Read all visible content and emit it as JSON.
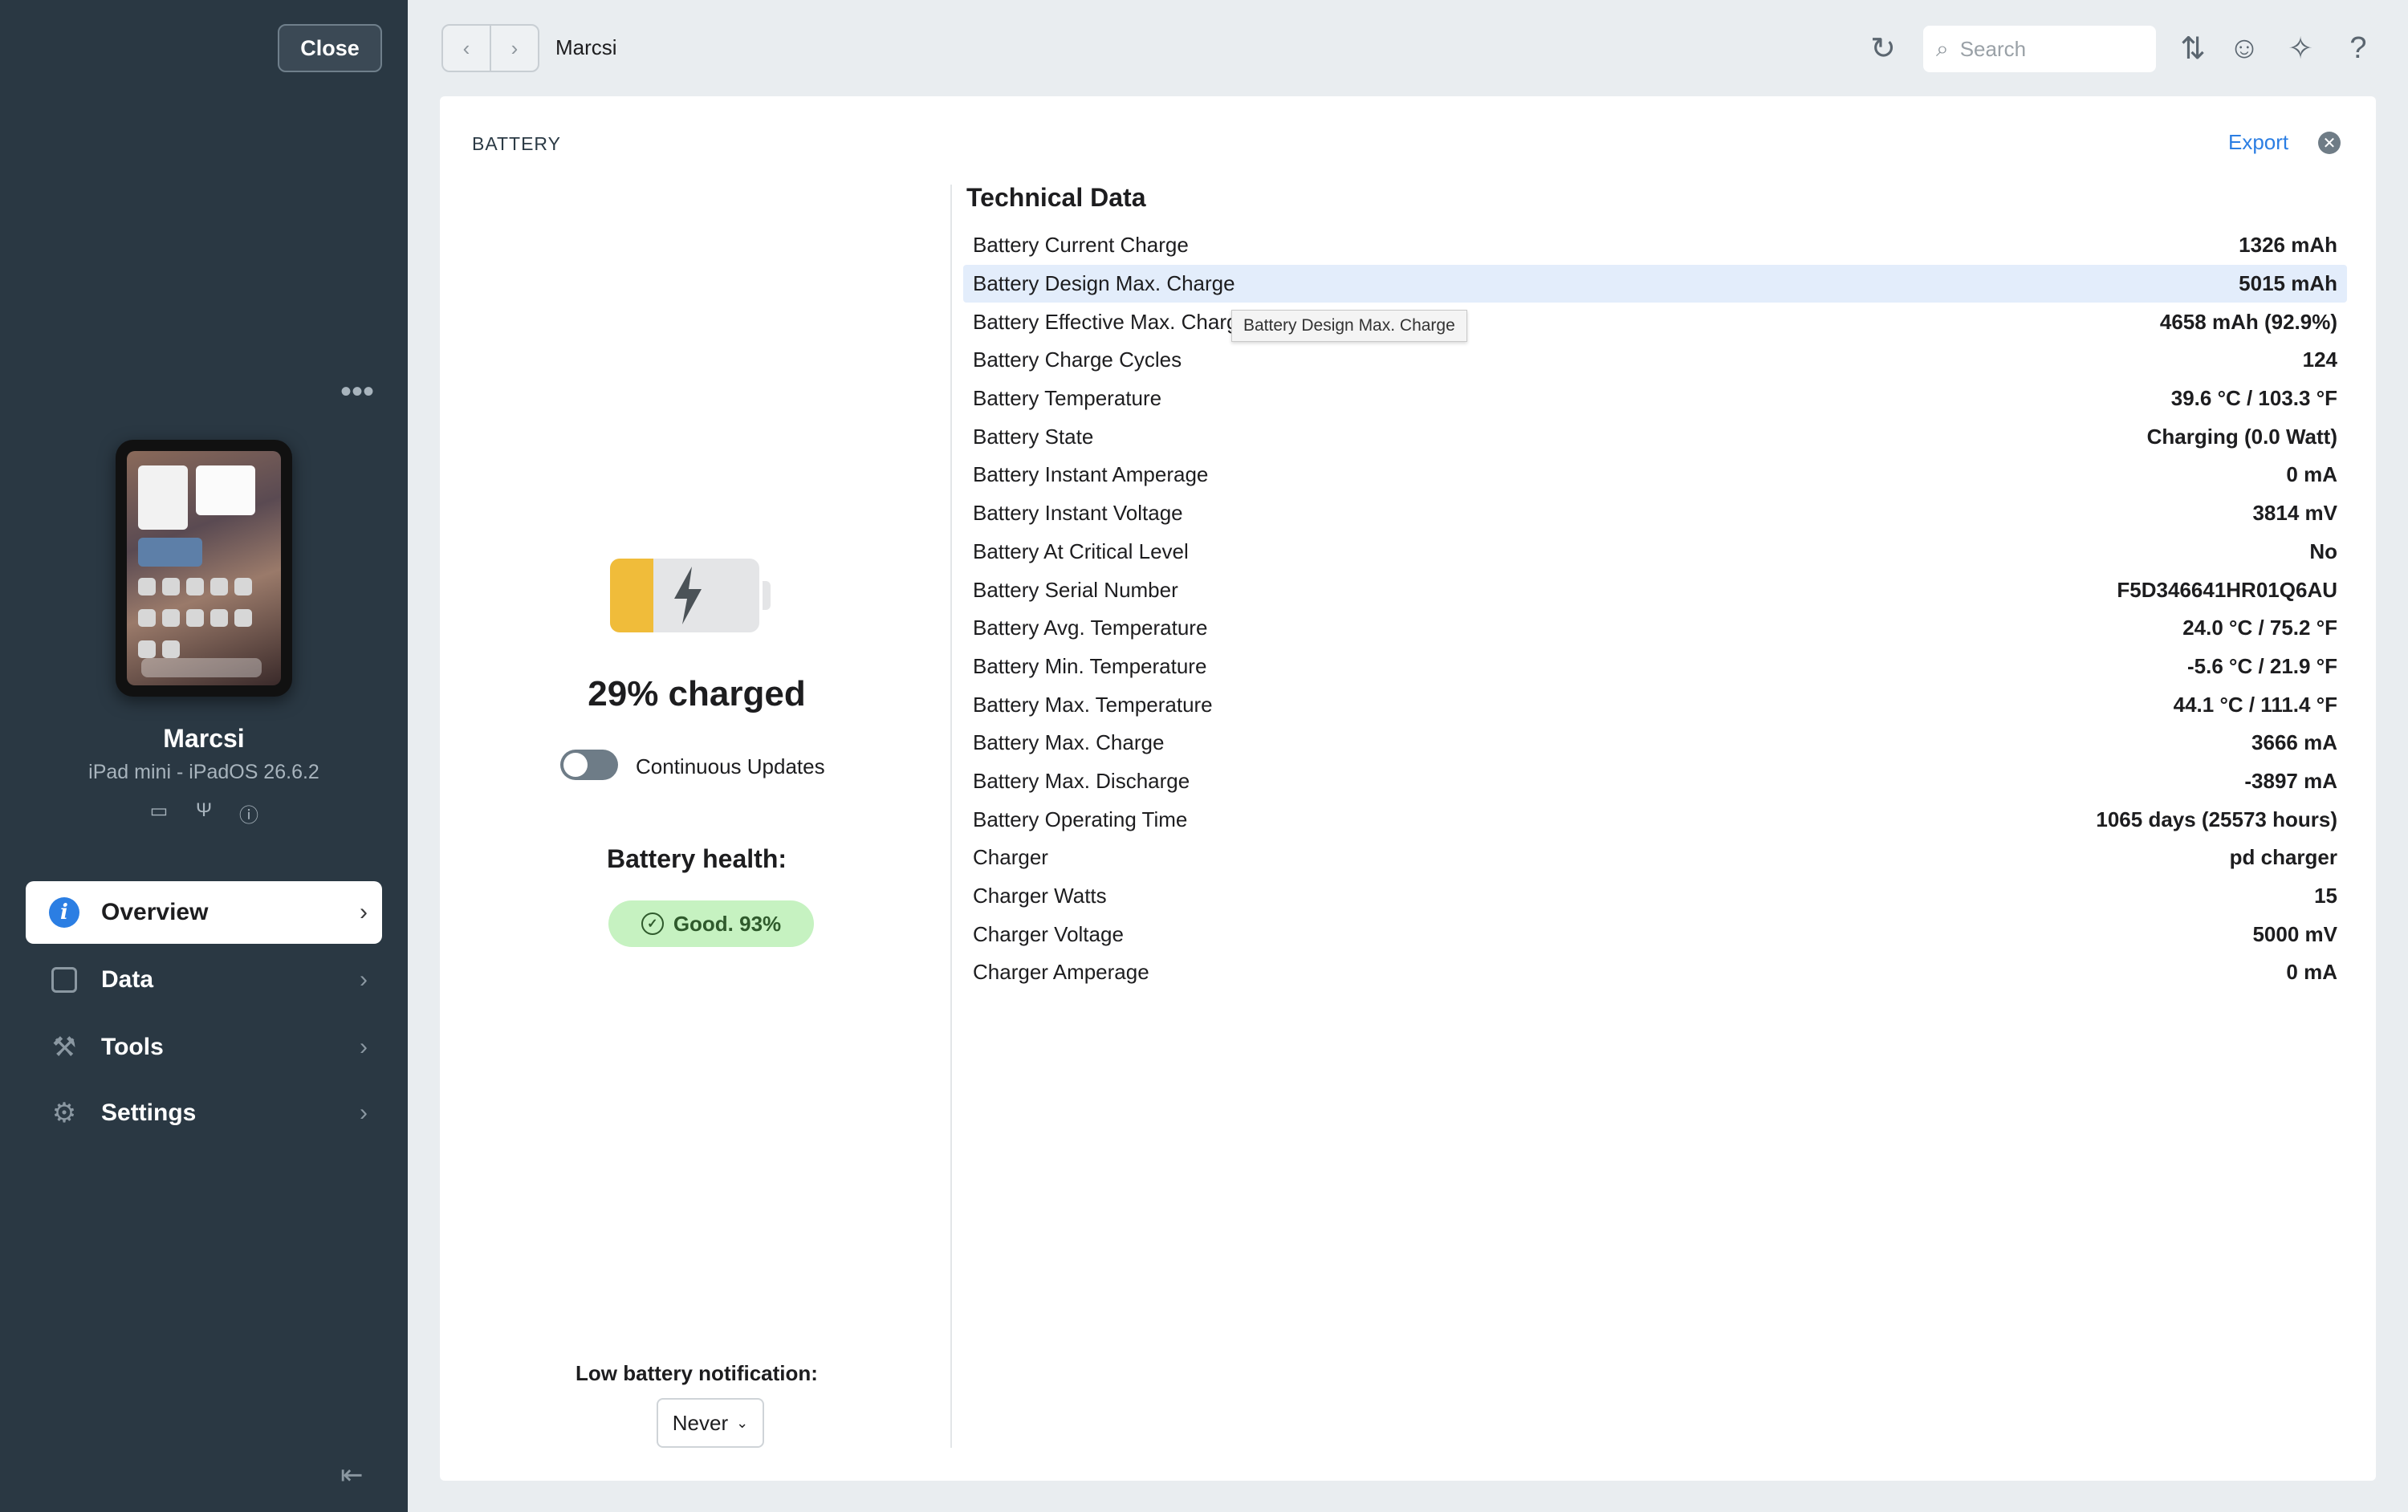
{
  "sidebar": {
    "close_label": "Close",
    "more_label": "•••",
    "device": {
      "name": "Marcsi",
      "model": "iPad mini - iPadOS 26.6.2"
    },
    "device_icons": [
      "battery-icon",
      "usb-icon",
      "info-icon"
    ],
    "nav": [
      {
        "label": "Overview",
        "icon": "info-icon",
        "active": true
      },
      {
        "label": "Data",
        "icon": "data-square-icon",
        "active": false
      },
      {
        "label": "Tools",
        "icon": "tools-icon",
        "active": false
      },
      {
        "label": "Settings",
        "icon": "gear-icon",
        "active": false
      }
    ]
  },
  "topbar": {
    "breadcrumb": "Marcsi",
    "search_placeholder": "Search"
  },
  "panel": {
    "title": "BATTERY",
    "export_label": "Export",
    "battery": {
      "level": 0.29,
      "charged_text": "29% charged",
      "continuous_updates_label": "Continuous Updates",
      "continuous_updates_on": false,
      "health_label": "Battery health:",
      "health_value": "Good. 93%",
      "low_battery_label": "Low battery notification:",
      "low_battery_value": "Never"
    },
    "technical": {
      "title": "Technical Data",
      "tooltip": "Battery Design Max. Charge",
      "rows": [
        {
          "label": "Battery Current Charge",
          "value": "1326 mAh"
        },
        {
          "label": "Battery Design Max. Charge",
          "value": "5015 mAh"
        },
        {
          "label": "Battery Effective Max. Charge",
          "value": "4658 mAh (92.9%)"
        },
        {
          "label": "Battery Charge Cycles",
          "value": "124"
        },
        {
          "label": "Battery Temperature",
          "value": "39.6 °C / 103.3 °F"
        },
        {
          "label": "Battery State",
          "value": "Charging (0.0 Watt)"
        },
        {
          "label": "Battery Instant Amperage",
          "value": "0 mA"
        },
        {
          "label": "Battery Instant Voltage",
          "value": "3814 mV"
        },
        {
          "label": "Battery At Critical Level",
          "value": "No"
        },
        {
          "label": "Battery Serial Number",
          "value": "F5D346641HR01Q6AU"
        },
        {
          "label": "Battery Avg. Temperature",
          "value": "24.0 °C / 75.2 °F"
        },
        {
          "label": "Battery Min. Temperature",
          "value": "-5.6 °C / 21.9 °F"
        },
        {
          "label": "Battery Max. Temperature",
          "value": "44.1 °C / 111.4 °F"
        },
        {
          "label": "Battery Max. Charge",
          "value": "3666 mA"
        },
        {
          "label": "Battery Max. Discharge",
          "value": "-3897 mA"
        },
        {
          "label": "Battery Operating Time",
          "value": "1065 days (25573 hours)"
        },
        {
          "label": "Charger",
          "value": "pd charger"
        },
        {
          "label": "Charger Watts",
          "value": "15"
        },
        {
          "label": "Charger Voltage",
          "value": "5000 mV"
        },
        {
          "label": "Charger Amperage",
          "value": "0 mA"
        }
      ]
    }
  },
  "colors": {
    "sidebar_bg": "#2a3843",
    "accent": "#2b7ee3",
    "battery_fill": "#f0bc3a",
    "health_bg": "#c6f2c1",
    "selected_row": "#e3edfb"
  }
}
